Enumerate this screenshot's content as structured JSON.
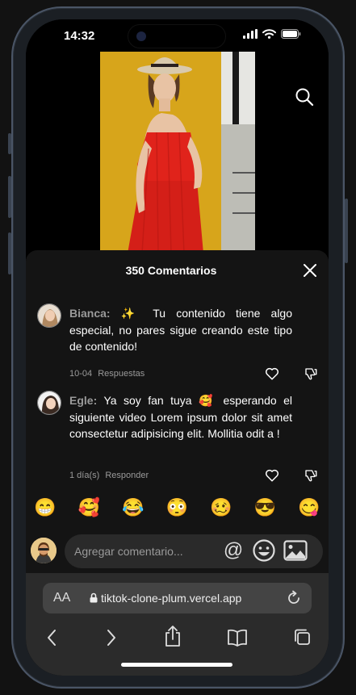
{
  "status_bar": {
    "time": "14:32"
  },
  "comments_panel": {
    "title": "350 Comentarios",
    "comments": [
      {
        "user": "Bianca:",
        "emoji": "✨",
        "text": "Tu contenido tiene algo especial, no pares sigue creando este tipo de contenido!",
        "date": "10-04",
        "action": "Respuestas"
      },
      {
        "user": "Egle:",
        "text_before": "Ya soy fan tuya",
        "emoji": "🥰",
        "text": "esperando el siguiente video Lorem ipsum dolor sit amet consectetur adipisicing elit. Mollitia odit a !",
        "date": "1 día(s)",
        "action": "Responder"
      }
    ],
    "emojis": [
      "😁",
      "🥰",
      "😂",
      "😳",
      "🥴",
      "😎",
      "😋"
    ],
    "input": {
      "placeholder": "Agregar comentario...",
      "at_symbol": "@"
    }
  },
  "browser": {
    "aa_label": "AA",
    "url": "tiktok-clone-plum.vercel.app"
  },
  "colors": {
    "panel_bg": "#141414",
    "input_bg": "#2a2a2a",
    "muted_text": "#9a9a9a",
    "photo_bg": "#d7a51b",
    "dress_red": "#e0231b"
  }
}
